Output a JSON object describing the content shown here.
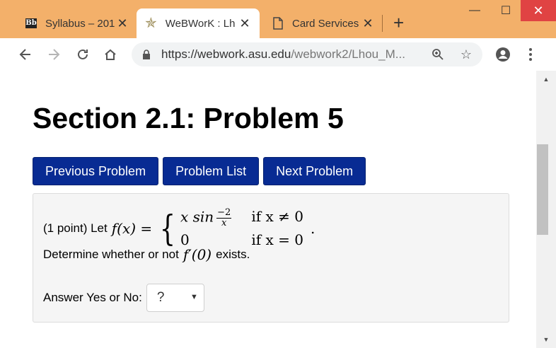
{
  "tabs": [
    {
      "label": "Syllabus – 201",
      "icon": "blackboard-icon",
      "active": false
    },
    {
      "label": "WeBWorK : Lh",
      "icon": "webwork-star-icon",
      "active": true
    },
    {
      "label": "Card Services",
      "icon": "document-icon",
      "active": false
    }
  ],
  "window_controls": {
    "minimize": "—",
    "maximize": "☐",
    "close": "✕"
  },
  "toolbar": {
    "url_host": "https://webwork.asu.edu",
    "url_path": "/webwork2/Lhou_M..."
  },
  "page": {
    "title": "Section 2.1: Problem 5",
    "nav_buttons": [
      "Previous Problem",
      "Problem List",
      "Next Problem"
    ],
    "problem": {
      "prefix": "(1 point) Let",
      "function_lhs": "f(x) =",
      "case1_expr_a": "x sin",
      "case1_frac_num": "−2",
      "case1_frac_den": "x",
      "case1_cond": "if  x ≠ 0",
      "case2_expr": "0",
      "case2_cond": "if  x = 0",
      "terminal": ".",
      "question_prefix": "Determine whether or not",
      "question_math": "f′(0)",
      "question_suffix": "exists.",
      "answer_label": "Answer Yes or No:",
      "answer_value": "?"
    }
  },
  "colors": {
    "window_frame": "#f3b06a",
    "nav_button_bg": "#082b93",
    "problem_bg": "#f5f5f5",
    "close_button": "#e04343"
  }
}
